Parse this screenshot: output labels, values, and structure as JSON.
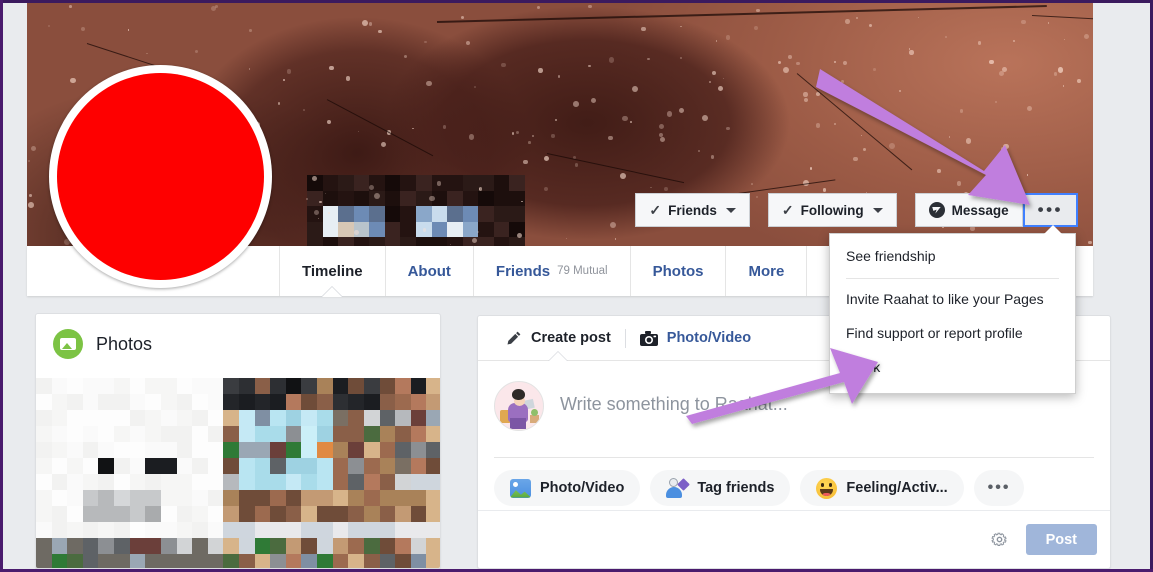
{
  "profile": {
    "avatar_label": "redacted-profile-photo",
    "cover_label": "cover-photo",
    "name_label": "redacted-name"
  },
  "action_bar": {
    "friends_label": "Friends",
    "following_label": "Following",
    "message_label": "Message",
    "more_options_label": "•••"
  },
  "menu": {
    "items": [
      {
        "label": "See friendship",
        "separator_after": true
      },
      {
        "label": "Invite Raahat to like your Pages",
        "separator_after": false
      },
      {
        "label": "Find support or report profile",
        "separator_after": false
      },
      {
        "label": "Block",
        "separator_after": false
      }
    ]
  },
  "tabs": [
    {
      "label": "Timeline",
      "sub": "",
      "active": true
    },
    {
      "label": "About",
      "sub": "",
      "active": false
    },
    {
      "label": "Friends",
      "sub": "79 Mutual",
      "active": false
    },
    {
      "label": "Photos",
      "sub": "",
      "active": false
    },
    {
      "label": "More",
      "sub": "",
      "active": false
    }
  ],
  "photos_card": {
    "title": "Photos"
  },
  "composer": {
    "tabs": [
      {
        "label": "Create post",
        "icon": "pencil-icon",
        "active": true
      },
      {
        "label": "Photo/Video",
        "icon": "camera-icon",
        "active": false
      }
    ],
    "placeholder": "Write something to Raahat...",
    "pills": [
      {
        "label": "Photo/Video",
        "icon": "photo-video-icon"
      },
      {
        "label": "Tag friends",
        "icon": "tag-friends-icon"
      },
      {
        "label": "Feeling/Activ...",
        "icon": "feeling-activity-icon"
      },
      {
        "label": "•••",
        "icon": "more-options-icon"
      }
    ],
    "settings_icon": "gear-icon",
    "post_label": "Post"
  },
  "annotations": {
    "arrow_color": "#c07ede",
    "arrow_1_target": "more-options-button",
    "arrow_2_target": "menu-item-block"
  },
  "colors": {
    "page_bg": "#e9ebee",
    "link_blue": "#365899",
    "text_dark": "#1d2129",
    "muted": "#90949c",
    "post_button": "#a0b6da",
    "accent_green": "#7cc344",
    "frame_purple": "#4a1b6d"
  }
}
